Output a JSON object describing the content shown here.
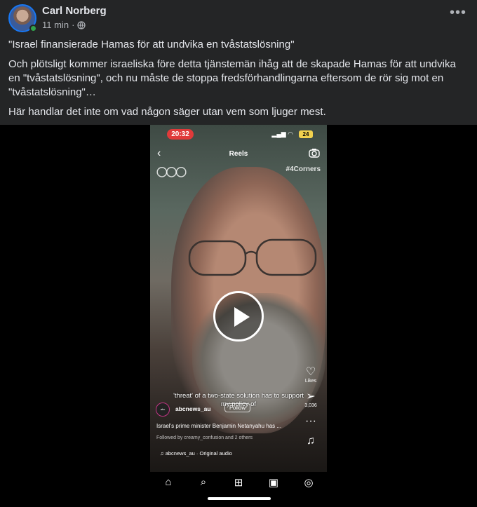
{
  "post": {
    "author": "Carl Norberg",
    "time": "11 min",
    "separator": "·",
    "paragraphs": [
      "\"Israel finansierade Hamas för att undvika en tvåstatslösning\"",
      "Och plötsligt kommer israeliska före detta tjänstemän ihåg att de skapade Hamas för att undvika en \"tvåstatslösning\", och nu måste de stoppa fredsförhandlingarna eftersom de rör sig mot en \"tvåstatslösning\"…",
      "Här handlar det inte om vad någon säger utan vem som ljuger mest."
    ],
    "more_icon": "more-horizontal-icon",
    "globe_icon": "globe-icon"
  },
  "video": {
    "status_time": "20:32",
    "battery": "24",
    "reels_title": "Reels",
    "hashtag": "#4Corners",
    "logo_text": "abc",
    "caption": "'threat' of a two-state solution has to support my policy of",
    "likes_label": "Likes",
    "share_count": "3,036",
    "account": "abcnews_au",
    "follow_label": "Follow",
    "description": "Israel's prime minister Benjamin Netanyahu has ...",
    "followed_by": "Followed by creamy_confusion and 2 others",
    "audio": "abcnews_au · Original audio"
  },
  "colors": {
    "background": "#242526",
    "text": "#e4e6eb",
    "secondary": "#b0b3b8",
    "online": "#31a24c",
    "recording_pill": "#e03a3a",
    "battery": "#f2d14e"
  }
}
